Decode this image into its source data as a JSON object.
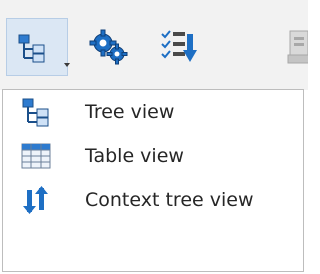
{
  "menu": {
    "items": [
      {
        "label": "Tree view",
        "icon": "tree-view-icon"
      },
      {
        "label": "Table view",
        "icon": "table-view-icon"
      },
      {
        "label": "Context tree view",
        "icon": "context-tree-view-icon"
      }
    ]
  },
  "toolbar": {
    "buttons": [
      {
        "icon": "tree-view-icon",
        "active": true,
        "has_dropdown": true
      },
      {
        "icon": "gears-icon",
        "active": false
      },
      {
        "icon": "checklist-sort-icon",
        "active": false
      },
      {
        "icon": "disabled-tool-icon",
        "active": false,
        "disabled": true
      }
    ]
  },
  "colors": {
    "accent_blue": "#1e6fc4",
    "active_button_bg": "#dbe7f4",
    "toolbar_bg": "#f2f2f2",
    "text": "#262626"
  }
}
